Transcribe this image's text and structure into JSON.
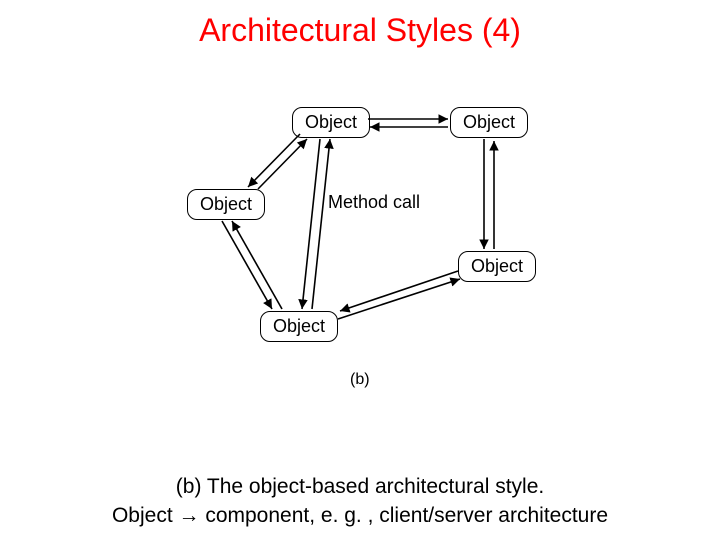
{
  "title": "Architectural Styles (4)",
  "nodes": {
    "top_left": {
      "label": "Object"
    },
    "top_right": {
      "label": "Object"
    },
    "mid_left": {
      "label": "Object"
    },
    "bot_right": {
      "label": "Object"
    },
    "bot_left": {
      "label": "Object"
    }
  },
  "method_call_label": "Method call",
  "figure_label": "(b)",
  "caption_line1": "(b) The object-based architectural style.",
  "caption_line2": "Object → component, e. g. , client/server architecture"
}
